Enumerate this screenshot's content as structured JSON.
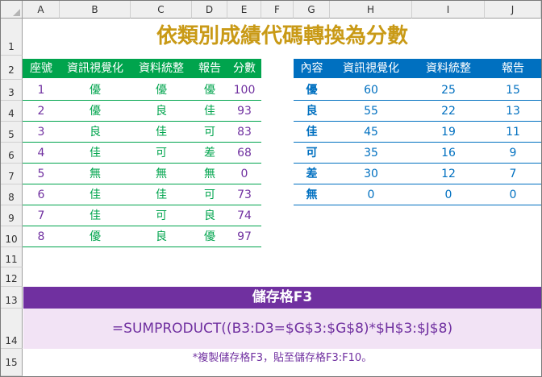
{
  "columns": [
    "A",
    "B",
    "C",
    "D",
    "E",
    "F",
    "G",
    "H",
    "I",
    "J"
  ],
  "rows": [
    "1",
    "2",
    "3",
    "4",
    "5",
    "6",
    "7",
    "8",
    "9",
    "10",
    "11",
    "12",
    "13",
    "14",
    "15"
  ],
  "title": "依類別成績代碼轉換為分數",
  "left_table": {
    "headers": [
      "座號",
      "資訊視覺化",
      "資料統整",
      "報告",
      "分數"
    ],
    "rows": [
      [
        "1",
        "優",
        "優",
        "優",
        "100"
      ],
      [
        "2",
        "優",
        "良",
        "佳",
        "93"
      ],
      [
        "3",
        "良",
        "佳",
        "可",
        "83"
      ],
      [
        "4",
        "佳",
        "可",
        "差",
        "68"
      ],
      [
        "5",
        "無",
        "無",
        "無",
        "0"
      ],
      [
        "6",
        "佳",
        "佳",
        "可",
        "73"
      ],
      [
        "7",
        "佳",
        "可",
        "良",
        "74"
      ],
      [
        "8",
        "優",
        "良",
        "優",
        "97"
      ]
    ]
  },
  "right_table": {
    "headers": [
      "內容",
      "資訊視覺化",
      "資料統整",
      "報告"
    ],
    "rows": [
      [
        "優",
        "60",
        "25",
        "15"
      ],
      [
        "良",
        "55",
        "22",
        "13"
      ],
      [
        "佳",
        "45",
        "19",
        "11"
      ],
      [
        "可",
        "35",
        "16",
        "9"
      ],
      [
        "差",
        "30",
        "12",
        "7"
      ],
      [
        "無",
        "0",
        "0",
        "0"
      ]
    ]
  },
  "formula_section": {
    "banner": "儲存格F3",
    "formula": "=SUMPRODUCT((B3:D3=$G$3:$G$8)*$H$3:$J$8)",
    "note": "*複製儲存格F3，貼至儲存格F3:F10。"
  },
  "colors": {
    "title": "#c99a16",
    "left_header_bg": "#00a44d",
    "left_text": "#7030a0",
    "left_grade": "#00a44d",
    "right_header_bg": "#0070c0",
    "right_text": "#0070c0",
    "banner_bg": "#7030a0",
    "formula_bg": "#f2e3f5"
  }
}
